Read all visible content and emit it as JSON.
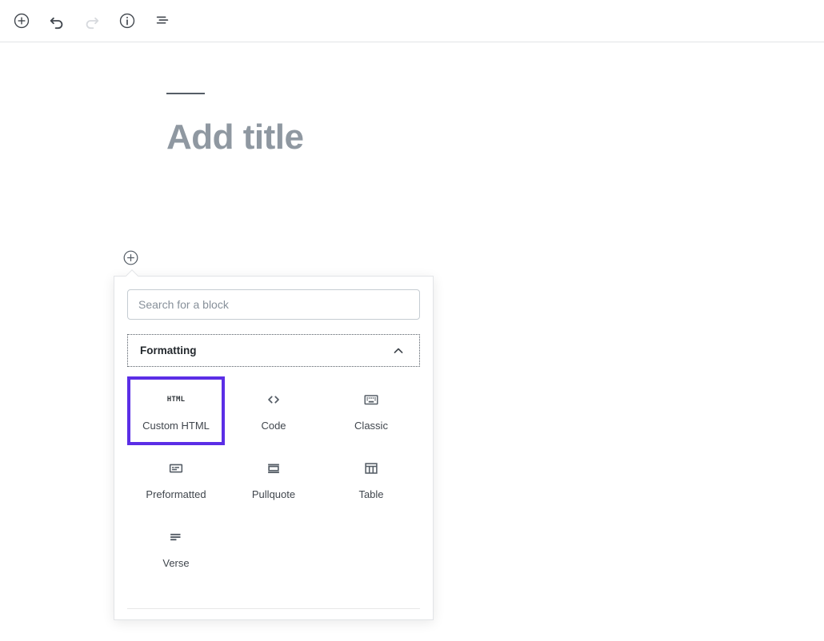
{
  "toolbar": {
    "buttons": [
      {
        "name": "add-block-icon",
        "label": "Add block",
        "icon": "circle-plus-icon",
        "disabled": false
      },
      {
        "name": "undo-icon",
        "label": "Undo",
        "icon": "undo-icon",
        "disabled": false
      },
      {
        "name": "redo-icon",
        "label": "Redo",
        "icon": "redo-icon",
        "disabled": true
      },
      {
        "name": "info-icon",
        "label": "Content structure",
        "icon": "circle-info-icon",
        "disabled": false
      },
      {
        "name": "list-view-icon",
        "label": "Block navigation",
        "icon": "list-view-icon",
        "disabled": false
      }
    ]
  },
  "editor": {
    "title_placeholder": "Add title",
    "inserter_toggle_label": "Add block"
  },
  "inserter": {
    "search": {
      "placeholder": "Search for a block",
      "value": ""
    },
    "panel": {
      "title": "Formatting",
      "expanded": true,
      "chevron": "chevron-up-icon"
    },
    "blocks": [
      {
        "label": "Custom HTML",
        "icon": "html-text-icon",
        "selected": true
      },
      {
        "label": "Code",
        "icon": "angle-brackets-icon",
        "selected": false
      },
      {
        "label": "Classic",
        "icon": "keyboard-icon",
        "selected": false
      },
      {
        "label": "Preformatted",
        "icon": "preformatted-icon",
        "selected": false
      },
      {
        "label": "Pullquote",
        "icon": "pullquote-icon",
        "selected": false
      },
      {
        "label": "Table",
        "icon": "table-icon",
        "selected": false
      },
      {
        "label": "Verse",
        "icon": "verse-lines-icon",
        "selected": false
      }
    ]
  },
  "colors": {
    "selection_outline": "#5b2ee6",
    "title_placeholder": "#8f98a1",
    "icon": "#555d66",
    "border": "#e2e4e7"
  }
}
